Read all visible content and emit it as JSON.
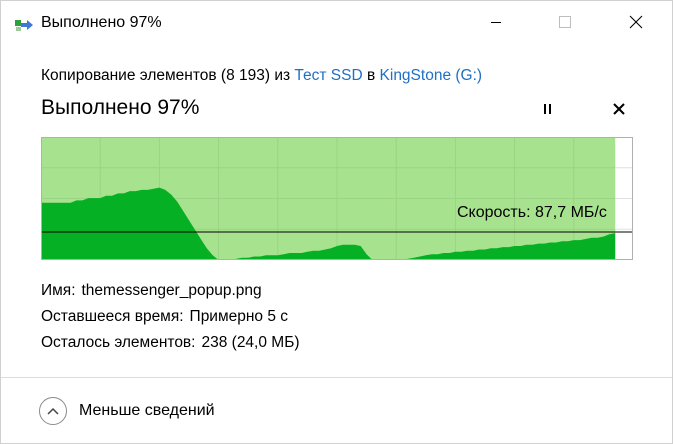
{
  "window": {
    "title": "Выполнено 97%",
    "minimize_icon": "minimize-icon",
    "maximize_icon": "maximize-icon",
    "close_icon": "close-icon"
  },
  "header": {
    "copy_prefix": "Копирование элементов (8 193) из ",
    "source": "Тест SSD",
    "copy_middle": " в ",
    "destination": "KingStone (G:)",
    "status_title": "Выполнено 97%",
    "pause_icon": "pause-icon",
    "stop_icon": "close-x-icon"
  },
  "chart_data": {
    "type": "area",
    "progress_percent": 97,
    "speed_label": "Скорость: 87,7 МБ/с",
    "current_speed_fraction": 0.24,
    "x": [
      0,
      1,
      2,
      3,
      4,
      5,
      6,
      7,
      8,
      9,
      10,
      11,
      12,
      13,
      14,
      15,
      16,
      17,
      18,
      19,
      20,
      21,
      22,
      23,
      24,
      25,
      26,
      27,
      28,
      29,
      30,
      31,
      32,
      33,
      34,
      35,
      36,
      37,
      38,
      39,
      40,
      41,
      42,
      43,
      44,
      45,
      46,
      47,
      48,
      49,
      50,
      51,
      52,
      53,
      54,
      55,
      56,
      57,
      58,
      59,
      60,
      61,
      62,
      63,
      64,
      65,
      66,
      67,
      68,
      69,
      70,
      71,
      72,
      73,
      74,
      75,
      76,
      77,
      78,
      79,
      80,
      81,
      82,
      83,
      84,
      85,
      86,
      87,
      88,
      89,
      90,
      91,
      92,
      93,
      94,
      95,
      96,
      97
    ],
    "values": [
      0.49,
      0.49,
      0.49,
      0.49,
      0.49,
      0.49,
      0.51,
      0.51,
      0.53,
      0.53,
      0.53,
      0.55,
      0.55,
      0.57,
      0.57,
      0.59,
      0.59,
      0.6,
      0.6,
      0.61,
      0.62,
      0.6,
      0.56,
      0.5,
      0.42,
      0.34,
      0.26,
      0.18,
      0.1,
      0.04,
      0.0,
      0.0,
      0.0,
      0.01,
      0.02,
      0.02,
      0.03,
      0.03,
      0.04,
      0.04,
      0.04,
      0.05,
      0.06,
      0.06,
      0.06,
      0.07,
      0.08,
      0.08,
      0.09,
      0.1,
      0.12,
      0.13,
      0.13,
      0.13,
      0.12,
      0.05,
      0.0,
      0.0,
      0.0,
      0.0,
      0.0,
      0.0,
      0.01,
      0.02,
      0.03,
      0.04,
      0.05,
      0.05,
      0.06,
      0.06,
      0.07,
      0.07,
      0.08,
      0.08,
      0.09,
      0.09,
      0.1,
      0.1,
      0.11,
      0.11,
      0.12,
      0.12,
      0.13,
      0.13,
      0.14,
      0.14,
      0.15,
      0.15,
      0.16,
      0.16,
      0.17,
      0.17,
      0.18,
      0.19,
      0.19,
      0.2,
      0.22,
      0.23
    ],
    "xlim": [
      0,
      100
    ],
    "ylim": [
      0,
      1
    ],
    "grid": true,
    "colors": {
      "completed_bg": "#a7e38e",
      "remaining_bg": "#ffffff",
      "area_fill": "#06b025",
      "border": "#b0b0b0",
      "grid": "#9ad484",
      "speed_line": "#000000"
    }
  },
  "details": {
    "name_label": "Имя:",
    "name_value": "themessenger_popup.png",
    "time_label": "Оставшееся время:",
    "time_value": "Примерно 5 с",
    "items_label": "Осталось элементов:",
    "items_value": "238 (24,0 МБ)"
  },
  "footer": {
    "less_label": "Меньше сведений",
    "less_icon": "chevron-up-icon"
  }
}
